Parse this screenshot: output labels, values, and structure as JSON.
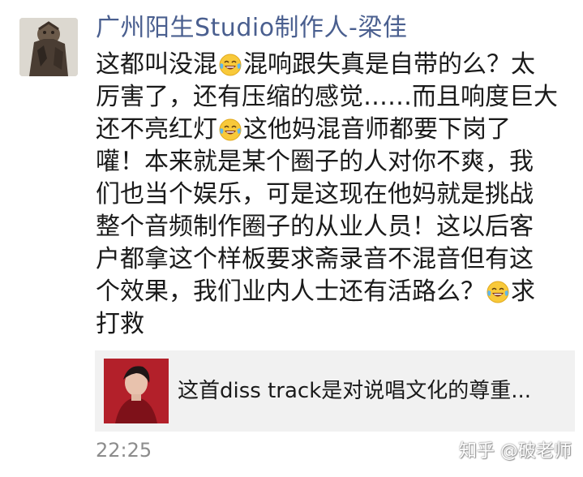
{
  "post": {
    "author_name": "广州阳生Studio制作人-梁佳",
    "message_lines": [
      [
        "这都叫没混",
        "laughing-tears-emoji",
        "混响跟失真是自带的么？太"
      ],
      [
        "厉害了，还有压缩的感觉……而且响度巨大"
      ],
      [
        "还不亮红灯",
        "laughing-tears-emoji",
        "这他妈混音师都要下岗了"
      ],
      [
        "嚾！本来就是某个圈子的人对你不爽，我"
      ],
      [
        "们也当个娱乐，可是这现在他妈就是挑战"
      ],
      [
        "整个音频制作圈子的从业人员！这以后客"
      ],
      [
        "户都拿这个样板要求斋录音不混音但有这"
      ],
      [
        "个效果，我们业内人士还有活路么？",
        "laughing-tears-emoji",
        "求"
      ],
      [
        "打救"
      ]
    ],
    "time": "22:25"
  },
  "shared_link": {
    "title": "这首diss track是对说唱文化的尊重..."
  },
  "watermark": "知乎 @破老师",
  "colors": {
    "author_name": "#4a5f8f",
    "text": "#1a1a1a",
    "time": "#8c8c8c",
    "card_bg": "#f1f1f1",
    "thumb_bg": "#b01e28"
  }
}
